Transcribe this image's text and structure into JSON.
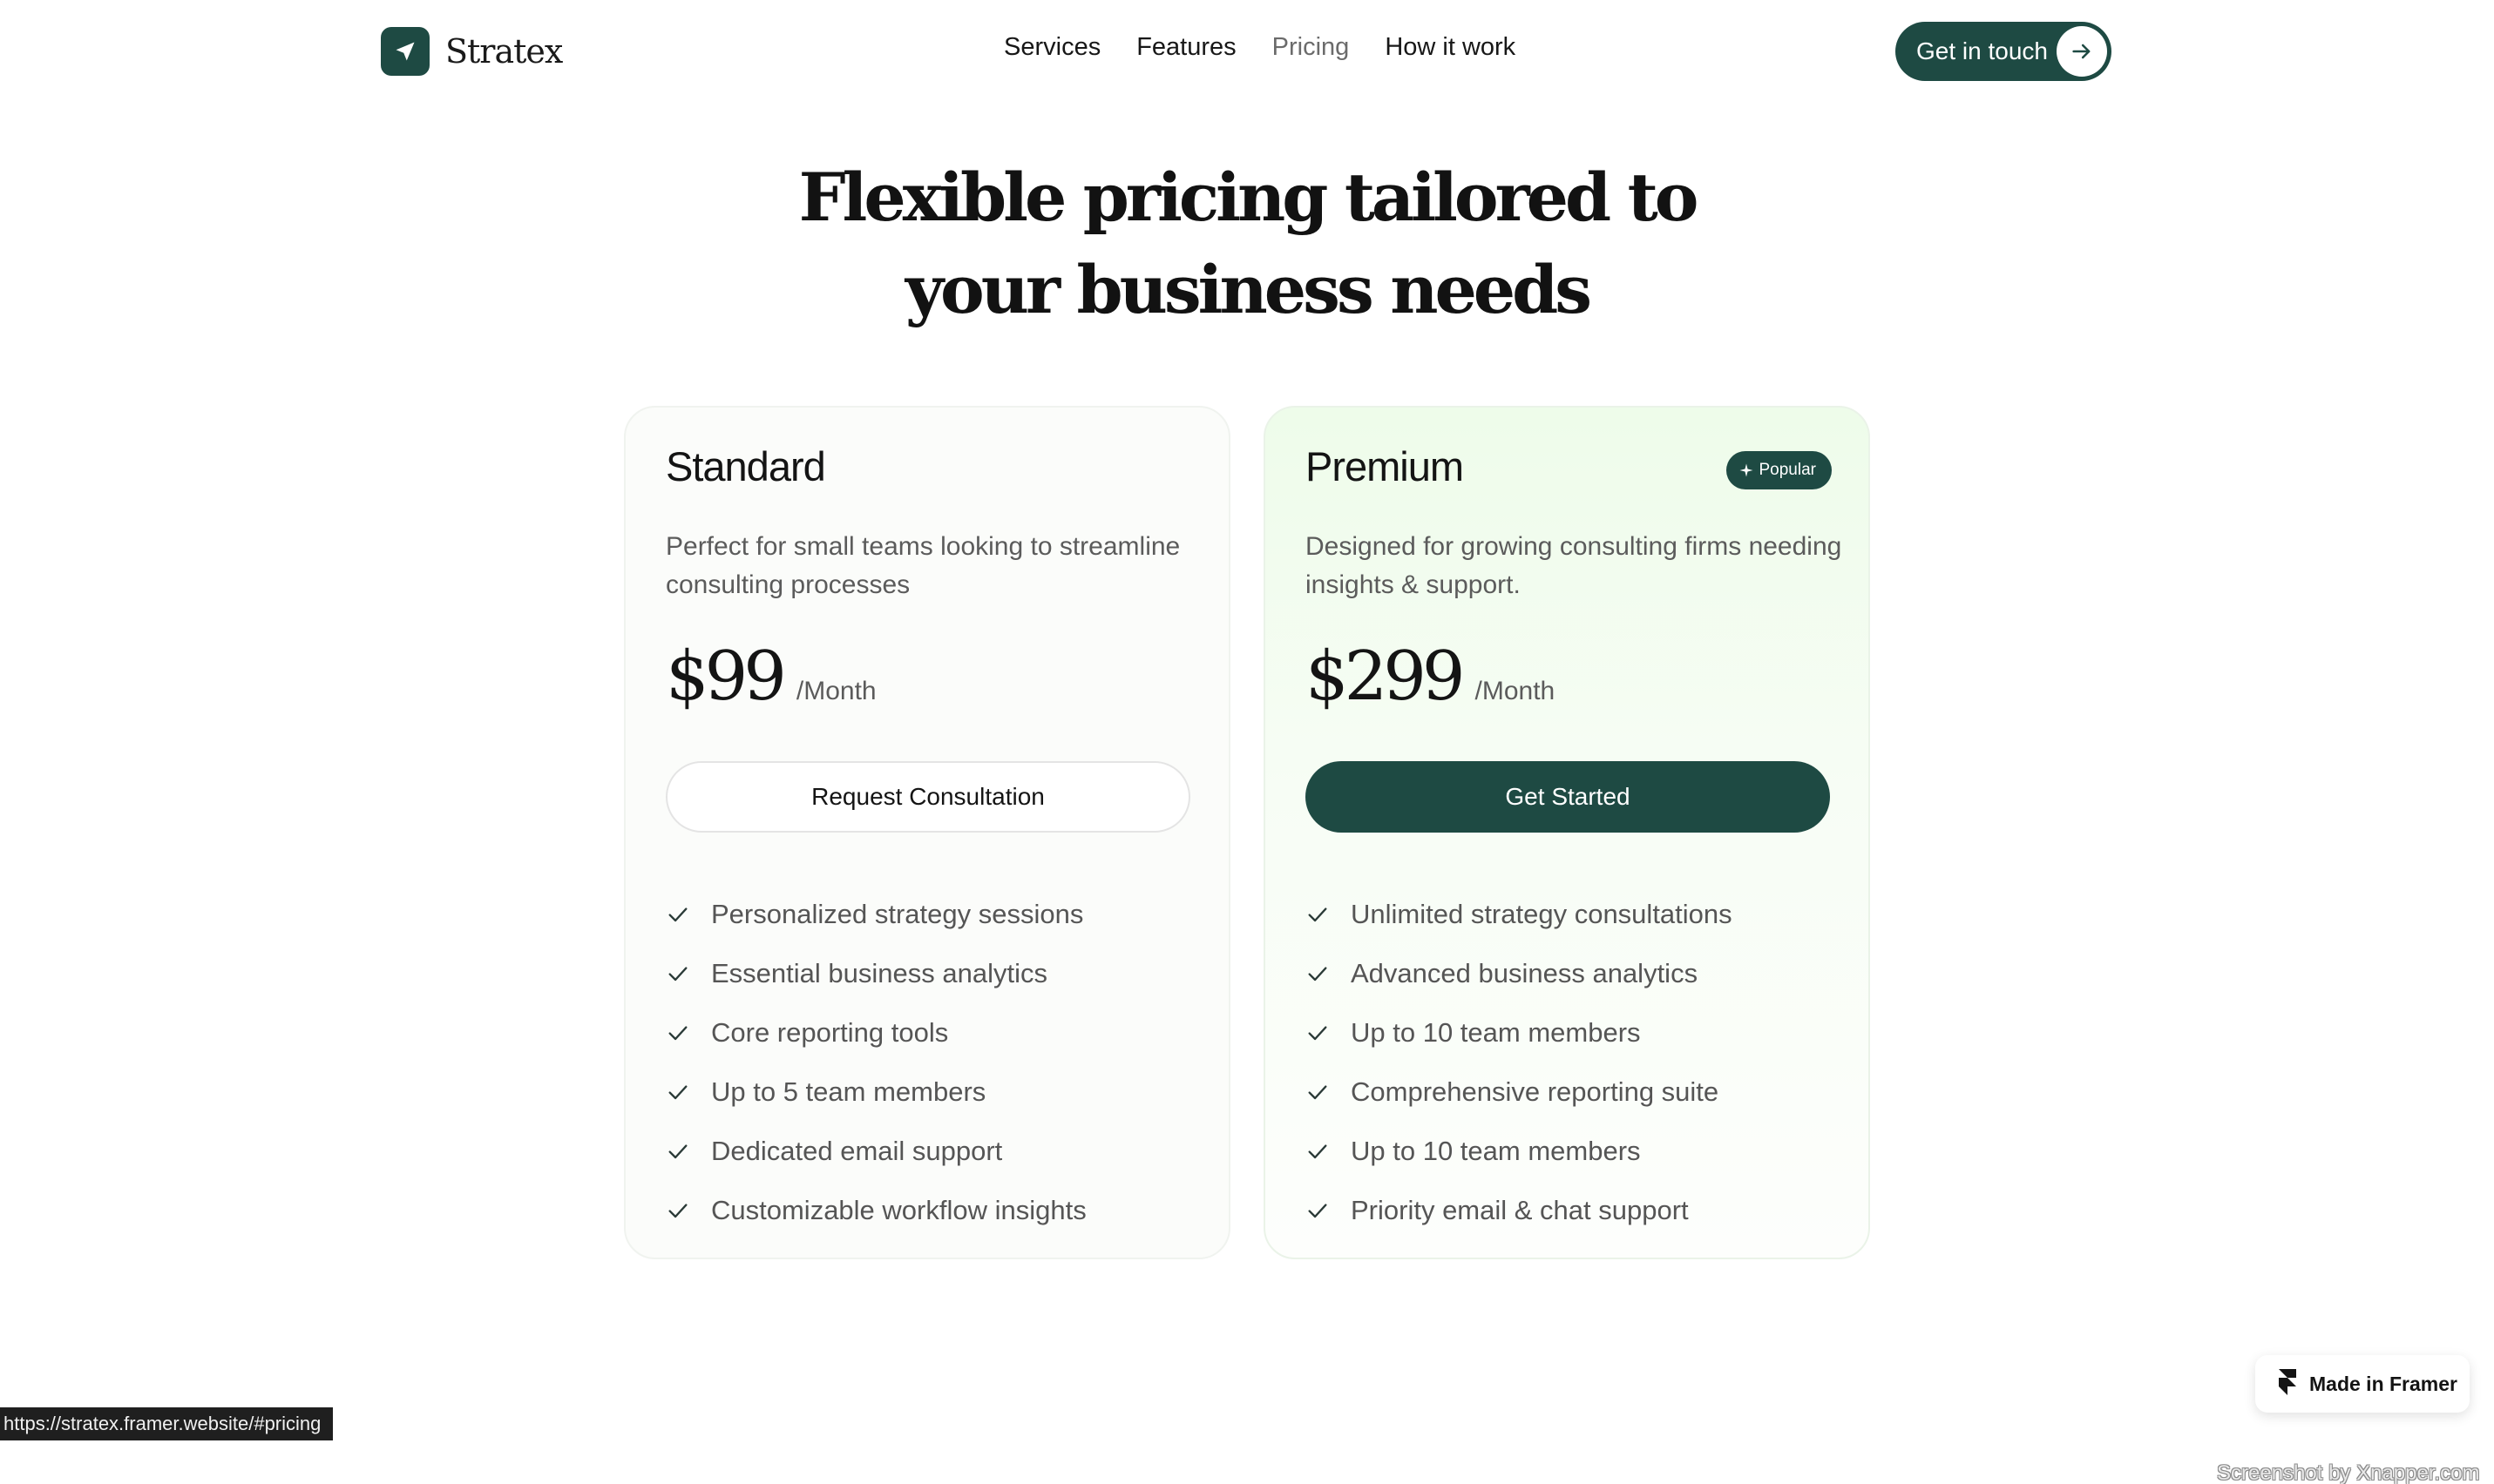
{
  "brand": {
    "name": "Stratex",
    "logo_icon": "paper-plane-icon"
  },
  "nav": {
    "items": [
      {
        "label": "Services",
        "active": false
      },
      {
        "label": "Features",
        "active": false
      },
      {
        "label": "Pricing",
        "active": true
      },
      {
        "label": "How it work",
        "active": false
      }
    ],
    "cta_label": "Get in touch",
    "cta_icon": "arrow-right-icon"
  },
  "hero": {
    "line1": "Flexible pricing tailored to",
    "line2": "your business needs"
  },
  "plans": [
    {
      "name": "Standard",
      "description": "Perfect for small teams looking to streamline consulting processes",
      "price": "$99",
      "period": "/Month",
      "button_label": "Request Consultation",
      "features": [
        "Personalized strategy sessions",
        "Essential business analytics",
        "Core reporting tools",
        "Up to 5 team members",
        "Dedicated email support",
        "Customizable workflow insights"
      ]
    },
    {
      "name": "Premium",
      "badge": "Popular",
      "description": "Designed for growing consulting firms needing insights & support.",
      "price": "$299",
      "period": "/Month",
      "button_label": "Get Started",
      "features": [
        "Unlimited strategy consultations",
        "Advanced business analytics",
        "Up to 10 team members",
        "Comprehensive reporting suite",
        "Up to 10 team members",
        "Priority email & chat support"
      ]
    }
  ],
  "status_url": "https://stratex.framer.website/#pricing",
  "framer_badge": "Made in Framer",
  "watermark": "Screenshot by Xnapper.com",
  "colors": {
    "primary": "#1e4a43",
    "premium_bg": "#eefcea",
    "text": "#141414",
    "muted": "#5b5b5b"
  }
}
